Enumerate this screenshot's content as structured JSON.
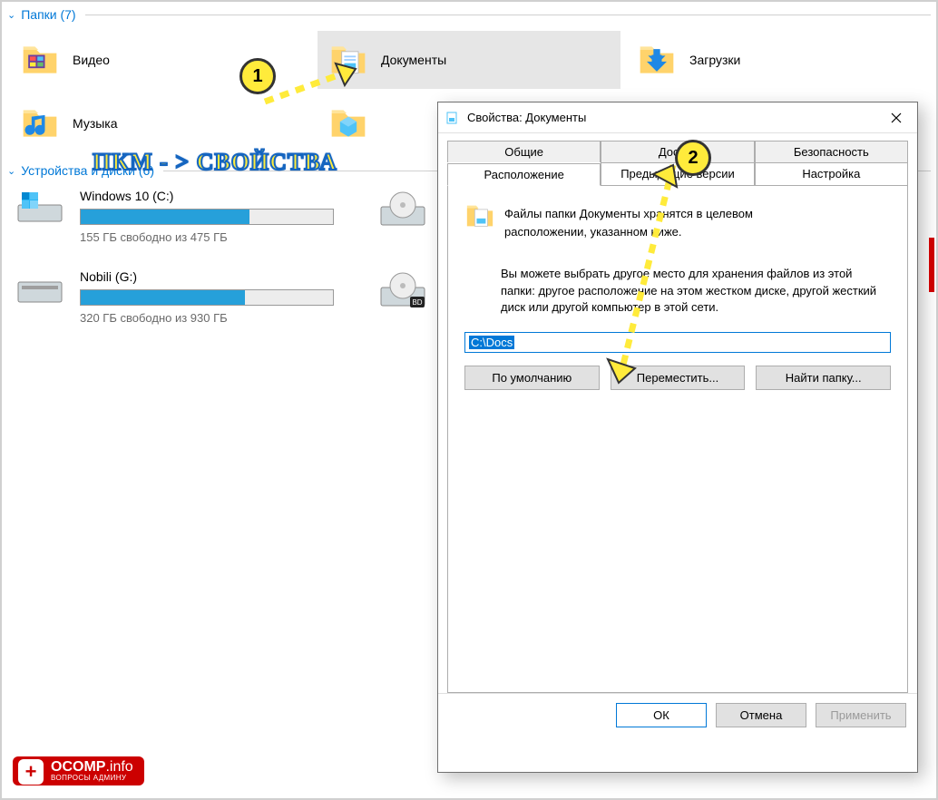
{
  "sections": {
    "folders_header": "Папки (7)",
    "drives_header": "Устройства и диски (6)"
  },
  "folders": [
    {
      "key": "video",
      "label": "Видео"
    },
    {
      "key": "documents",
      "label": "Документы",
      "selected": true
    },
    {
      "key": "downloads",
      "label": "Загрузки"
    },
    {
      "key": "music",
      "label": "Музыка"
    },
    {
      "key": "objects3d",
      "label": ""
    }
  ],
  "drives": [
    {
      "name": "Windows 10 (C:)",
      "fill_pct": 67,
      "free_text": "155 ГБ свободно из 475 ГБ",
      "right": "dvd"
    },
    {
      "name": "Nobili (G:)",
      "fill_pct": 65,
      "free_text": "320 ГБ свободно из 930 ГБ",
      "right": "bd"
    }
  ],
  "callouts": {
    "badge1": "1",
    "badge2": "2",
    "text": "ПКМ - > СВОЙСТВА"
  },
  "dialog": {
    "title": "Свойства: Документы",
    "tabs_row1": [
      "Общие",
      "Доступ",
      "Безопасность"
    ],
    "tabs_row2": [
      "Расположение",
      "Предыдущие версии",
      "Настройка"
    ],
    "active_tab": "Расположение",
    "info_line1": "Файлы папки Документы хранятся в целевом",
    "info_line2": "расположении, указанном ниже.",
    "info_para": "Вы можете выбрать другое место для хранения файлов из этой папки: другое расположение на этом жестком диске, другой жесткий диск или другой компьютер в этой сети.",
    "path_value": "C:\\Docs",
    "btn_default": "По умолчанию",
    "btn_move": "Переместить...",
    "btn_find": "Найти папку...",
    "btn_ok": "ОК",
    "btn_cancel": "Отмена",
    "btn_apply": "Применить"
  },
  "watermark": {
    "brand": "OCOMP",
    "tld": ".info",
    "sub": "ВОПРОСЫ АДМИНУ"
  }
}
